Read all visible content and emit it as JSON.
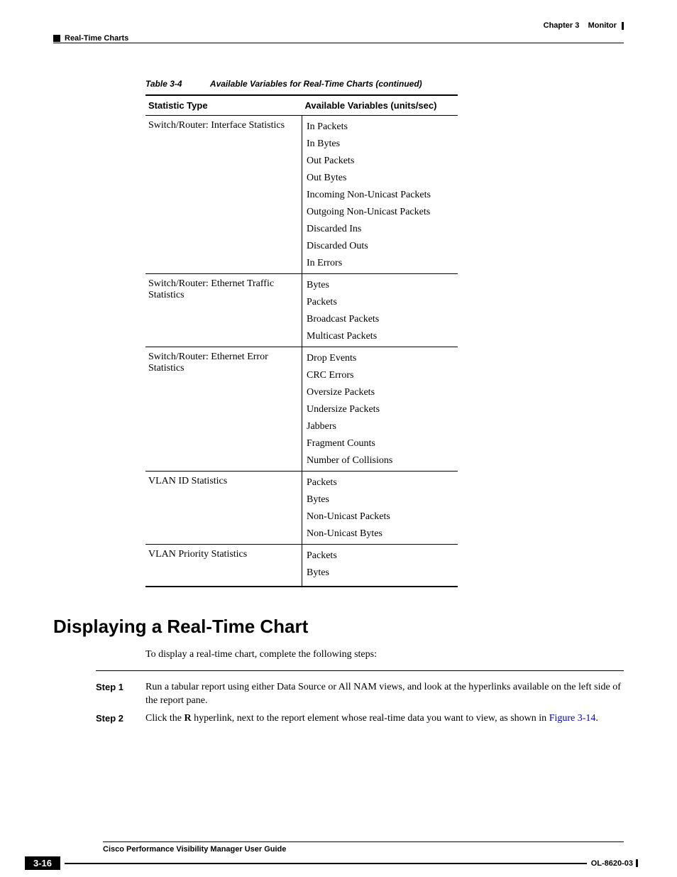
{
  "header": {
    "chapter_label": "Chapter 3",
    "chapter_title": "Monitor",
    "section": "Real-Time Charts"
  },
  "table": {
    "number": "Table 3-4",
    "title": "Available Variables for Real-Time Charts (continued)",
    "col1": "Statistic Type",
    "col2": "Available Variables (units/sec)",
    "rows": [
      {
        "type": "Switch/Router: Interface Statistics",
        "vars": [
          "In Packets",
          "In Bytes",
          "Out Packets",
          "Out Bytes",
          "Incoming Non-Unicast Packets",
          "Outgoing Non-Unicast Packets",
          "Discarded Ins",
          "Discarded Outs",
          "In Errors"
        ]
      },
      {
        "type": "Switch/Router: Ethernet Traffic Statistics",
        "vars": [
          "Bytes",
          "Packets",
          "Broadcast Packets",
          "Multicast Packets"
        ]
      },
      {
        "type": "Switch/Router: Ethernet Error Statistics",
        "vars": [
          "Drop Events",
          "CRC Errors",
          "Oversize Packets",
          "Undersize Packets",
          "Jabbers",
          "Fragment Counts",
          "Number of Collisions"
        ]
      },
      {
        "type": "VLAN ID Statistics",
        "vars": [
          "Packets",
          "Bytes",
          "Non-Unicast Packets",
          "Non-Unicast Bytes"
        ]
      },
      {
        "type": "VLAN Priority Statistics",
        "vars": [
          "Packets",
          "Bytes"
        ]
      }
    ]
  },
  "section": {
    "title": "Displaying a Real-Time Chart",
    "intro": "To display a real-time chart, complete the following steps:",
    "steps": [
      {
        "label": "Step 1",
        "text": "Run a tabular report using either Data Source or All NAM views, and look at the hyperlinks available on the left side of the report pane."
      },
      {
        "label": "Step 2",
        "prefix": "Click the ",
        "bold": "R",
        "middle": " hyperlink, next to the report element whose real-time data you want to view, as shown in ",
        "link": "Figure 3-14",
        "suffix": "."
      }
    ]
  },
  "footer": {
    "guide": "Cisco Performance Visibility Manager User Guide",
    "page": "3-16",
    "doc": "OL-8620-03"
  }
}
